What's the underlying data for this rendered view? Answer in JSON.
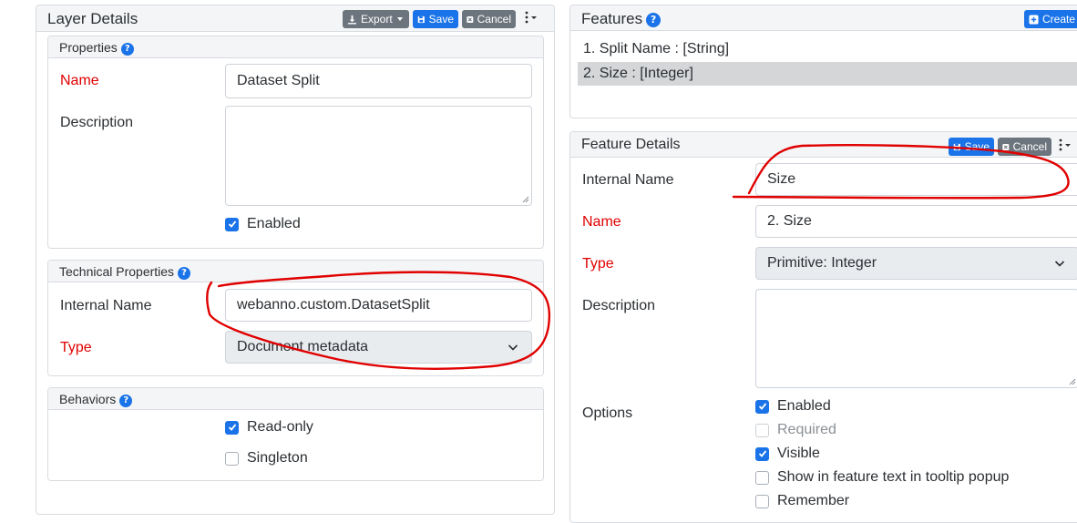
{
  "layer_details": {
    "title": "Layer Details",
    "buttons": {
      "export": "Export",
      "save": "Save",
      "cancel": "Cancel"
    },
    "properties": {
      "title": "Properties",
      "name_label": "Name",
      "name_value": "Dataset Split",
      "description_label": "Description",
      "description_value": "",
      "enabled_label": "Enabled",
      "enabled": true
    },
    "technical": {
      "title": "Technical Properties",
      "internal_name_label": "Internal Name",
      "internal_name_value": "webanno.custom.DatasetSplit",
      "type_label": "Type",
      "type_value": "Document metadata"
    },
    "behaviors": {
      "title": "Behaviors",
      "readonly_label": "Read-only",
      "readonly": true,
      "singleton_label": "Singleton",
      "singleton": false
    }
  },
  "features": {
    "title": "Features",
    "create_label": "Create",
    "items": [
      {
        "label": "1. Split Name : [String]",
        "selected": false
      },
      {
        "label": "2. Size : [Integer]",
        "selected": true
      }
    ]
  },
  "feature_details": {
    "title": "Feature Details",
    "buttons": {
      "save": "Save",
      "cancel": "Cancel"
    },
    "internal_name_label": "Internal Name",
    "internal_name_value": "Size",
    "name_label": "Name",
    "name_value": "2. Size",
    "type_label": "Type",
    "type_value": "Primitive: Integer",
    "description_label": "Description",
    "description_value": "",
    "options_label": "Options",
    "options": [
      {
        "label": "Enabled",
        "checked": true,
        "disabled": false
      },
      {
        "label": "Required",
        "checked": false,
        "disabled": true
      },
      {
        "label": "Visible",
        "checked": true,
        "disabled": false
      },
      {
        "label": "Show in feature text in tooltip popup",
        "checked": false,
        "disabled": false
      },
      {
        "label": "Remember",
        "checked": false,
        "disabled": false
      }
    ]
  },
  "colors": {
    "accent": "#1a73e8",
    "required": "#e00000",
    "annotation": "#e00000"
  }
}
